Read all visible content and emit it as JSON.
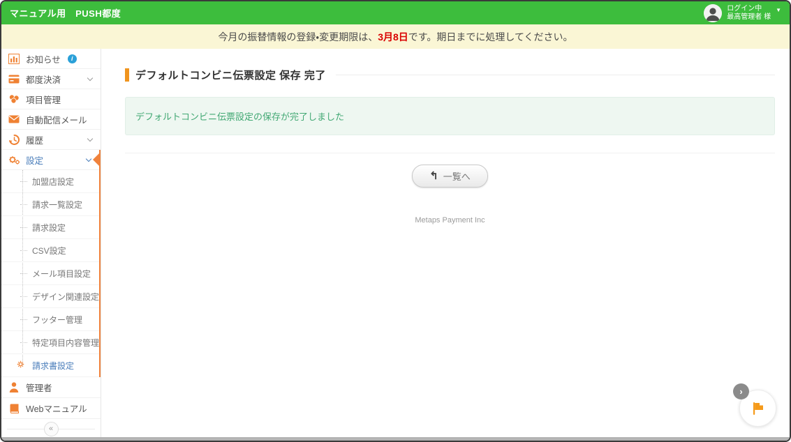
{
  "header": {
    "title": "マニュアル用　PUSH都度",
    "login_status": "ログイン中",
    "user_name": "最高管理者 様"
  },
  "banner": {
    "text_before": "今月の振替情報の登録・変更期限は、",
    "deadline": "3月8日",
    "text_after": "です。期日までに処理してください。"
  },
  "sidebar": {
    "items": [
      {
        "label": "お知らせ",
        "icon": "bar-chart-icon",
        "badge": "i"
      },
      {
        "label": "都度決済",
        "icon": "credit-card-icon",
        "expandable": true
      },
      {
        "label": "項目管理",
        "icon": "coins-icon"
      },
      {
        "label": "自動配信メール",
        "icon": "envelope-icon"
      },
      {
        "label": "履歴",
        "icon": "history-icon",
        "expandable": true
      },
      {
        "label": "設定",
        "icon": "gears-icon",
        "expandable": true,
        "active": true
      }
    ],
    "submenu": [
      "加盟店設定",
      "請求一覧設定",
      "請求設定",
      "CSV設定",
      "メール項目設定",
      "デザイン関連設定",
      "フッター管理",
      "特定項目内容管理",
      "請求書設定"
    ],
    "submenu_active": "請求書設定",
    "bottom_items": [
      {
        "label": "管理者",
        "icon": "person-icon"
      },
      {
        "label": "Webマニュアル",
        "icon": "book-icon"
      }
    ]
  },
  "main": {
    "heading": "デフォルトコンビニ伝票設定 保存 完了",
    "success_message": "デフォルトコンビニ伝票設定の保存が完了しました",
    "back_button_label": "一覧へ",
    "footer": "Metaps Payment Inc"
  },
  "icons": {
    "collapse": "«",
    "caret": "▼",
    "back_arrow": "↰",
    "widget_chevron": "›",
    "info_badge": "i"
  },
  "colors": {
    "header_green": "#3dbd3d",
    "banner_yellow": "#faf6d5",
    "banner_red": "#d90000",
    "accent_orange": "#f0823c",
    "heading_orange": "#f0941e",
    "active_blue": "#4a7dba",
    "info_blue": "#2aa0d8",
    "success_green_text": "#41a873",
    "success_green_bg": "#eef7f1"
  }
}
